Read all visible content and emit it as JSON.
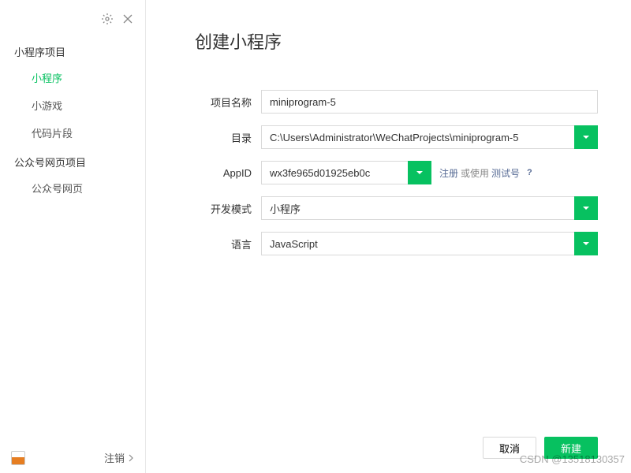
{
  "sidebar": {
    "sections": [
      {
        "title": "小程序项目",
        "items": [
          "小程序",
          "小游戏",
          "代码片段"
        ]
      },
      {
        "title": "公众号网页项目",
        "items": [
          "公众号网页"
        ]
      }
    ],
    "active_item": "小程序",
    "logout_label": "注销"
  },
  "page": {
    "title": "创建小程序"
  },
  "form": {
    "project_name": {
      "label": "项目名称",
      "value": "miniprogram-5"
    },
    "directory": {
      "label": "目录",
      "value": "C:\\Users\\Administrator\\WeChatProjects\\miniprogram-5"
    },
    "appid": {
      "label": "AppID",
      "value": "wx3fe965d01925eb0c",
      "links": {
        "register": "注册",
        "or_use": "或使用",
        "test": "测试号",
        "help": "?"
      }
    },
    "dev_mode": {
      "label": "开发模式",
      "value": "小程序"
    },
    "language": {
      "label": "语言",
      "value": "JavaScript"
    }
  },
  "footer": {
    "cancel": "取消",
    "confirm": "新建"
  },
  "watermark": "CSDN @13518130357",
  "colors": {
    "accent": "#07c160",
    "link": "#576b95"
  }
}
